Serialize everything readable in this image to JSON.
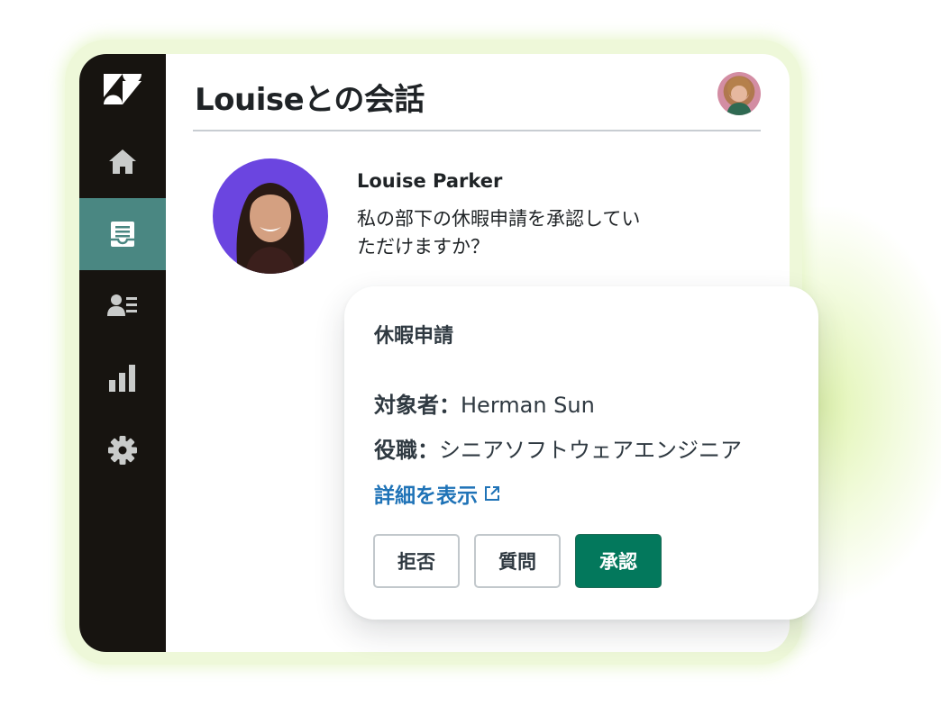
{
  "app": {
    "brand_icon": "zendesk-logo",
    "nav": [
      {
        "icon": "home-icon",
        "active": false
      },
      {
        "icon": "inbox-icon",
        "active": true
      },
      {
        "icon": "contacts-icon",
        "active": false
      },
      {
        "icon": "bar-chart-icon",
        "active": false
      },
      {
        "icon": "gear-icon",
        "active": false
      }
    ],
    "colors": {
      "sidebar": "#171410",
      "active_nav": "#4a8782",
      "approve": "#03785c",
      "link": "#1f73b7"
    }
  },
  "conversation": {
    "title": "Louiseとの会話",
    "sender_name": "Louise Parker",
    "message_line1": "私の部下の休暇申請を承認してい",
    "message_line2": "ただけますか？"
  },
  "request_card": {
    "title": "休暇申請",
    "target_label": "対象者：",
    "target_value": "Herman Sun",
    "role_label": "役職：",
    "role_value": "シニアソフトウェアエンジニア",
    "details_link": "詳細を表示",
    "buttons": {
      "reject": "拒否",
      "question": "質問",
      "approve": "承認"
    }
  }
}
